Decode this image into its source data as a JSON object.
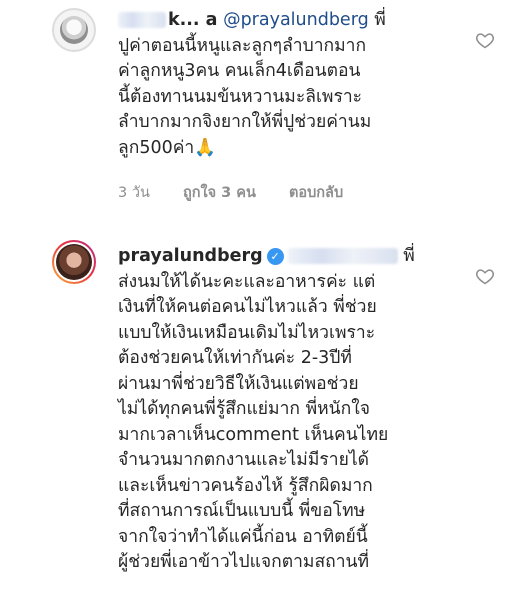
{
  "comment1": {
    "username_visible": "k...  a",
    "mention": "@prayalundberg",
    "first_line_tail": "พี่",
    "lines": [
      "ปูค่าตอนนี้หนูและลูกๆลำบากมาก",
      "ค่าลูกหนู3คน คนเล็ก4เดือนตอน",
      "นี้ต้องทานนมข้นหวานมะลิเพราะ",
      "ลำบากมากจิงยากให้พี่ปูช่วยค่านม",
      "ลูก500ค่า🙏"
    ],
    "time": "3 วัน",
    "likes": "ถูกใจ 3 คน",
    "reply": "ตอบกลับ",
    "like_icon": "heart-outline-icon"
  },
  "comment2": {
    "username": "prayalundberg",
    "verified_icon": "verified-badge-icon",
    "first_line_tail": "พี่",
    "lines": [
      "ส่งนมให้ได้นะคะและอาหารค่ะ แต่",
      "เงินที่ให้คนต่อคนไม่ไหวแล้ว พี่ช่วย",
      "แบบให้เงินเหมือนเดิมไม่ไหวเพราะ",
      "ต้องช่วยคนให้เท่ากันค่ะ 2-3ปีที่",
      "ผ่านมาพี่ช่วยวิธีให้เงินแต่พอช่วย",
      "ไม่ได้ทุกคนพี่รู้สึกแย่มาก พี่หนักใจ",
      "มากเวลาเห็นcomment เห็นคนไทย",
      "จำนวนมากตกงานและไม่มีรายได้",
      "และเห็นข่าวคนร้องไห้ รู้สึกผิดมาก",
      "ที่สถานการณ์เป็นแบบนี้ พี่ขอโทษ",
      "จากใจว่าทำได้แค่นี้ก่อน อาทิตย์นี้",
      "ผู้ช่วยพี่เอาข้าวไปแจกตามสถานที่"
    ],
    "like_icon": "heart-outline-icon"
  }
}
